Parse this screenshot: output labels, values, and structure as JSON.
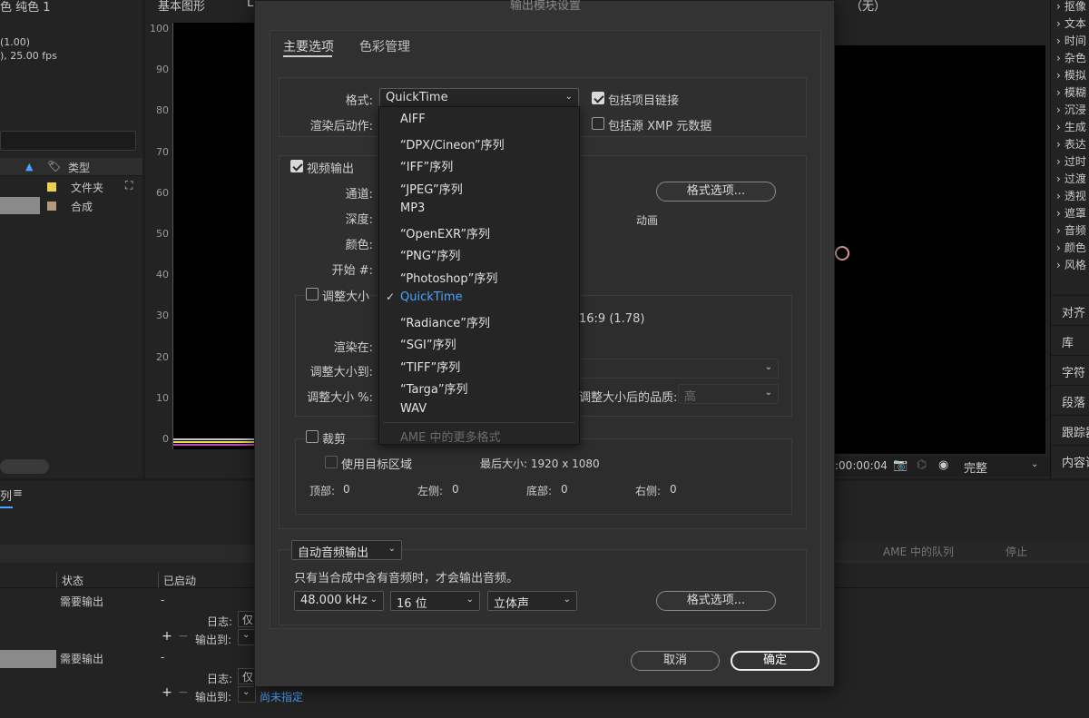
{
  "project": {
    "comp_title": "色 纯色 1",
    "comp_ratio": "(1.00)",
    "comp_fps": "), 25.00 fps",
    "type_header": "类型",
    "rows": [
      {
        "type": "文件夹",
        "color": "#e8d44d"
      },
      {
        "type": "合成",
        "color": "#b79a7d"
      }
    ]
  },
  "histogram": {
    "tab_label": "基本图形",
    "y_ticks": [
      "100",
      "90",
      "80",
      "70",
      "60",
      "50",
      "40",
      "30",
      "20",
      "10",
      "0"
    ]
  },
  "viewer": {
    "header_text": "（无）",
    "timecode": ":00:00:04",
    "quality": "完整"
  },
  "effects": {
    "items": [
      "抠像",
      "文本",
      "时间",
      "杂色",
      "模拟",
      "模糊",
      "沉浸",
      "生成",
      "表达",
      "过时",
      "过渡",
      "透视",
      "遮罩",
      "音频",
      "颜色",
      "风格"
    ],
    "side_buttons": [
      "对齐",
      "库",
      "字符",
      "段落",
      "跟踪器",
      "内容识"
    ]
  },
  "queue": {
    "tab_label": "列",
    "menu_icon": "≡",
    "ame_queue": "AME 中的队列",
    "stop": "停止",
    "col_status": "状态",
    "col_started": "已启动",
    "items": [
      {
        "status": "需要输出",
        "started": "-",
        "log_label": "日志:",
        "log_value": "仅",
        "output_label": "输出到:"
      },
      {
        "status": "需要输出",
        "started": "-",
        "log_label": "日志:",
        "log_value": "仅",
        "output_label": "输出到:",
        "output_value": "尚未指定"
      }
    ]
  },
  "dialog": {
    "title": "输出模块设置",
    "tabs": [
      "主要选项",
      "色彩管理"
    ],
    "format_label": "格式:",
    "format_value": "QuickTime",
    "post_render_label": "渲染后动作:",
    "include_project_link": "包括项目链接",
    "include_xmp": "包括源 XMP 元数据",
    "video_output": "视频输出",
    "channel_label": "通道:",
    "depth_label": "深度:",
    "color_label": "颜色:",
    "start_label": "开始 #:",
    "format_options_btn": "格式选项...",
    "animation": "动画",
    "resize": "调整大小",
    "aspect": "16:9 (1.78)",
    "render_at_label": "渲染在:",
    "resize_to_label": "调整大小到:",
    "resize_pct_label": "调整大小 %:",
    "resize_quality_label": "调整大小后的品质:",
    "resize_quality_value": "高",
    "crop": "裁剪",
    "use_roi": "使用目标区域",
    "final_size": "最后大小: 1920 x 1080",
    "top_label": "顶部:",
    "top_value": "0",
    "left_label": "左侧:",
    "left_value": "0",
    "bottom_label": "底部:",
    "bottom_value": "0",
    "right_label": "右侧:",
    "right_value": "0",
    "audio_output": "自动音频输出",
    "audio_note": "只有当合成中含有音频时，才会输出音频。",
    "sample_rate": "48.000 kHz",
    "bit_depth": "16 位",
    "channels": "立体声",
    "audio_format_options_btn": "格式选项...",
    "cancel": "取消",
    "ok": "确定",
    "format_menu": {
      "items": [
        "AIFF",
        "“DPX/Cineon”序列",
        "“IFF”序列",
        "“JPEG”序列",
        "MP3",
        "“OpenEXR”序列",
        "“PNG”序列",
        "“Photoshop”序列",
        "QuickTime",
        "“Radiance”序列",
        "“SGI”序列",
        "“TIFF”序列",
        "“Targa”序列",
        "WAV"
      ],
      "selected": "QuickTime",
      "more": "AME 中的更多格式"
    }
  },
  "colors": {
    "accent_blue": "#4aa3ff",
    "panel_bg": "#232323",
    "dialog_bg": "#333333"
  }
}
